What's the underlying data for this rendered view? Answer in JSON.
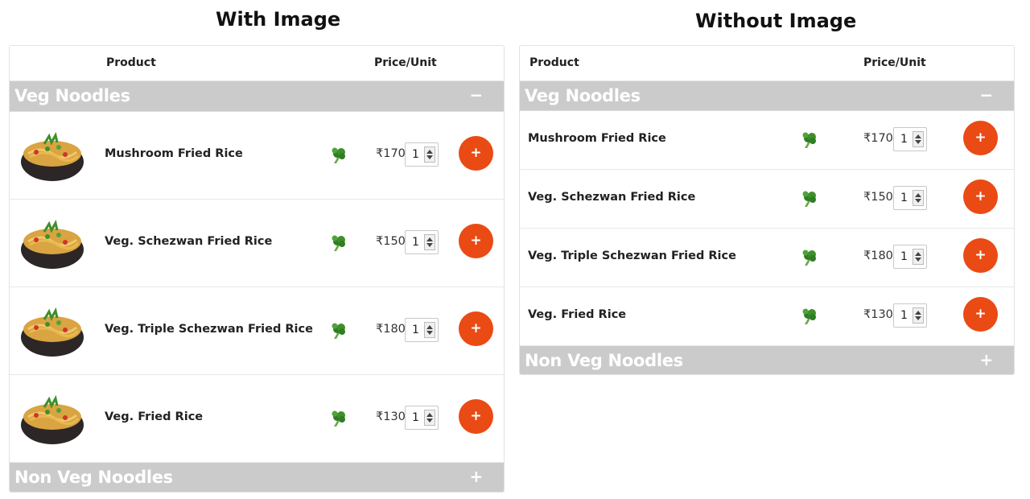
{
  "titles": {
    "with_image": "With Image",
    "without_image": "Without Image"
  },
  "headers": {
    "product": "Product",
    "price": "Price/Unit"
  },
  "categories": {
    "veg": {
      "label": "Veg Noodles",
      "toggle": "−"
    },
    "nonveg": {
      "label": "Non Veg Noodles",
      "toggle": "+"
    }
  },
  "items": [
    {
      "name": "Mushroom Fried Rice",
      "price": "₹170",
      "qty": "1"
    },
    {
      "name": "Veg. Schezwan Fried Rice",
      "price": "₹150",
      "qty": "1"
    },
    {
      "name": "Veg. Triple Schezwan Fried Rice",
      "price": "₹180",
      "qty": "1"
    },
    {
      "name": "Veg. Fried Rice",
      "price": "₹130",
      "qty": "1"
    }
  ],
  "add_label": "+",
  "colors": {
    "accent": "#ea4a14",
    "category_bg": "#cbcbcb",
    "veg_green": "#3f8f2a"
  },
  "icons": {
    "veg": "broccoli-icon",
    "add": "plus-icon",
    "dish": "noodle-bowl-image"
  }
}
